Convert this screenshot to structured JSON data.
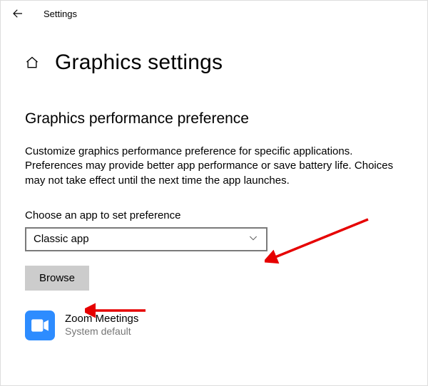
{
  "window": {
    "title": "Settings"
  },
  "header": {
    "page_title": "Graphics settings"
  },
  "section": {
    "title": "Graphics performance preference",
    "description": "Customize graphics performance preference for specific applications. Preferences may provide better app performance or save battery life. Choices may not take effect until the next time the app launches.",
    "choose_label": "Choose an app to set preference",
    "dropdown_value": "Classic app",
    "browse_label": "Browse"
  },
  "apps": [
    {
      "name": "Zoom Meetings",
      "preference": "System default",
      "icon": "zoom-icon"
    }
  ]
}
